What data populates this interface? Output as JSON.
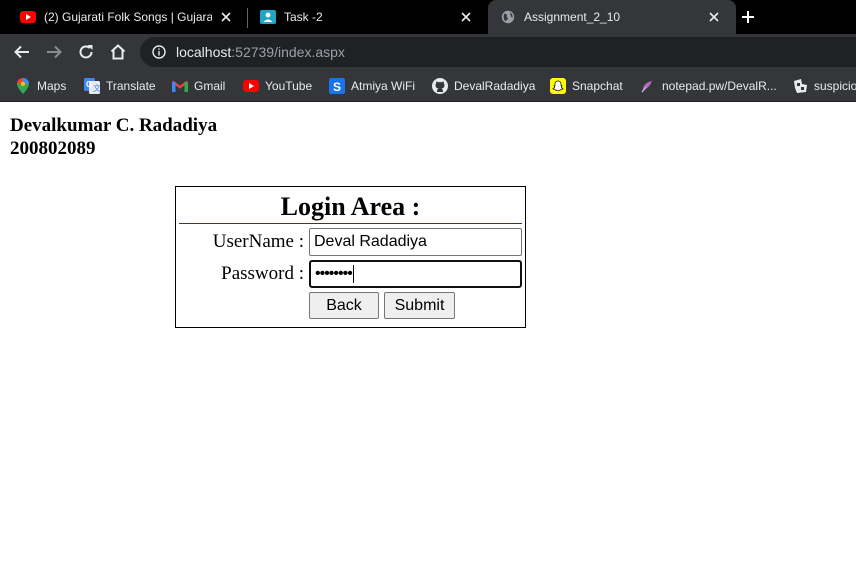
{
  "browser": {
    "tabs": [
      {
        "title": "(2) Gujarati Folk Songs | Gujarati",
        "icon": "youtube-icon",
        "active": false
      },
      {
        "title": "Task -2",
        "icon": "classroom-icon",
        "active": false
      },
      {
        "title": "Assignment_2_10",
        "icon": "globe-icon",
        "active": true
      }
    ],
    "address": {
      "host": "localhost",
      "rest": ":52739/index.aspx"
    },
    "bookmarks": [
      {
        "label": "Maps",
        "icon": "maps-icon"
      },
      {
        "label": "Translate",
        "icon": "translate-icon"
      },
      {
        "label": "Gmail",
        "icon": "gmail-icon"
      },
      {
        "label": "YouTube",
        "icon": "youtube-icon"
      },
      {
        "label": "Atmiya WiFi",
        "icon": "atmiya-wifi-icon"
      },
      {
        "label": "DevalRadadiya",
        "icon": "github-icon"
      },
      {
        "label": "Snapchat",
        "icon": "snapchat-icon"
      },
      {
        "label": "notepad.pw/DevalR...",
        "icon": "notepad-icon"
      },
      {
        "label": "suspicio",
        "icon": "suspicious-icon"
      }
    ]
  },
  "page": {
    "student_name": "Devalkumar C. Radadiya",
    "student_id": "200802089",
    "login": {
      "title": "Login Area :",
      "username_label": "UserName :",
      "username_value": "Deval Radadiya",
      "password_label": "Password :",
      "password_masked": "••••••••",
      "back_label": "Back",
      "submit_label": "Submit"
    }
  },
  "colors": {
    "tab_strip": "#000000",
    "toolbar": "#35363a",
    "omnibox": "#202124",
    "header_rule": "#7a1f1f"
  }
}
